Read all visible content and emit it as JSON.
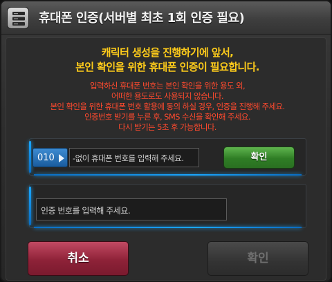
{
  "window": {
    "title": "휴대폰 인증(서버별 최초 1회 인증 필요)",
    "icon": "server-icon"
  },
  "headline": {
    "line1": "캐릭터 생성을 진행하기에 앞서,",
    "line2": "본인 확인을 위한 휴대폰 인증이 필요합니다."
  },
  "notice": {
    "lines": [
      "입력하신 휴대폰 번호는 본인 확인을 위한 용도 외,",
      "어떠한 용도로도 사용되지 않습니다.",
      "본인 확인을 위한 휴대폰 번호 활용에 동의 하실 경우, 인증을 진행해 주세요.",
      "인증번호 받기를 누른 후, SMS 수신을 확인해 주세요.",
      "다시 받기는 5초 후 가능합니다."
    ],
    "color": "#ff4a2e"
  },
  "phone": {
    "country_code": "010",
    "placeholder": "-없이 휴대폰 번호를 입력해 주세요.",
    "verify_label": "확인"
  },
  "code": {
    "placeholder": "인증 번호를 입력해 주세요."
  },
  "footer": {
    "cancel_label": "취소",
    "confirm_label": "확인"
  },
  "colors": {
    "headline": "#ffcc1a",
    "accent_glow": "#1aa7ff",
    "verify_button": "#2f7d25",
    "cancel_button": "#8e2238"
  }
}
